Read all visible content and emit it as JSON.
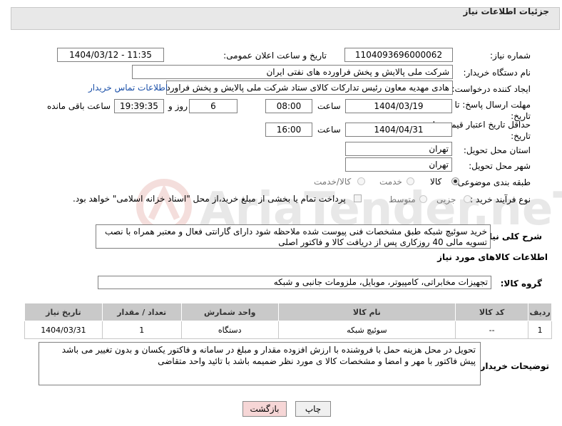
{
  "header": {
    "title": "جزئیات اطلاعات نیاز"
  },
  "fields": {
    "need_number_label": "شماره نیاز:",
    "need_number": "1104093696000062",
    "announce_label": "تاریخ و ساعت اعلان عمومی:",
    "announce_value": "1404/03/12 - 11:35",
    "buyer_org_label": "نام دستگاه خریدار:",
    "buyer_org": "شرکت ملی پالایش و پخش فراورده های نفتی ایران",
    "creator_label": "ایجاد کننده درخواست:",
    "creator": "هادی مهدیه معاون رئیس تدارکات کالای ستاد شرکت ملی پالایش و پخش فراورده",
    "contact_link": "اطلاعات تماس خریدار",
    "reply_deadline_label": "مهلت ارسال پاسخ: تا تاریخ:",
    "reply_date": "1404/03/19",
    "time_word": "ساعت",
    "reply_time": "08:00",
    "days_value": "6",
    "days_word": "روز و",
    "remaining_time": "19:39:35",
    "remaining_word": "ساعت باقی مانده",
    "price_validity_label": "حداقل تاریخ اعتبار قیمت: تا تاریخ:",
    "price_date": "1404/04/31",
    "price_time": "16:00",
    "province_label": "استان محل تحویل:",
    "province": "تهران",
    "city_label": "شهر محل تحویل:",
    "city": "تهران",
    "category_label": "طبقه بندی موضوعی:",
    "category_options": [
      "کالا",
      "خدمت",
      "کالا/خدمت"
    ],
    "purchase_type_label": "نوع فرآیند خرید :",
    "purchase_options": [
      "جزیی",
      "متوسط"
    ],
    "payment_note": "پرداخت تمام یا بخشی از مبلغ خرید،از محل \"اسناد خزانه اسلامی\" خواهد بود."
  },
  "description": {
    "label": "شرح کلی نیاز:",
    "text": "خرید سوئیچ شبکه طبق مشخصات فنی پیوست شده ملاحظه شود دارای گارانتی فعال و معتبر همراه با نصب تسویه مالی 40 روزکاری پس از دریافت کالا و فاکتور اصلی"
  },
  "goods_section": {
    "title": "اطلاعات کالاهای مورد نیاز",
    "group_label": "گروه کالا:",
    "group_value": "تجهیزات مخابراتی، کامپیوتر، موبایل، ملزومات جانبی و شبکه"
  },
  "table": {
    "headers": [
      "ردیف",
      "کد کالا",
      "نام کالا",
      "واحد شمارش",
      "تعداد / مقدار",
      "تاریخ نیاز"
    ],
    "rows": [
      [
        "1",
        "--",
        "سوئیچ شبکه",
        "دستگاه",
        "1",
        "1404/03/31"
      ]
    ]
  },
  "buyer_notes": {
    "label": "توضیحات خریدار:",
    "text": "تحویل در محل هزینه حمل با فروشنده با ارزش افزوده مقدار و مبلغ در سامانه و فاکتور یکسان و بدون تغییر می باشد پیش فاکتور با مهر و امضا و مشخصات کالا ی مورد نظر ضمیمه باشد با تائید واحد متقاضی"
  },
  "buttons": {
    "print": "چاپ",
    "back": "بازگشت"
  },
  "watermark_text": "AriaTender.neT",
  "colors": {
    "link": "#1a4fa8",
    "table_header": "#c9c9c9",
    "back_button_bg": "#f6d6d6"
  }
}
